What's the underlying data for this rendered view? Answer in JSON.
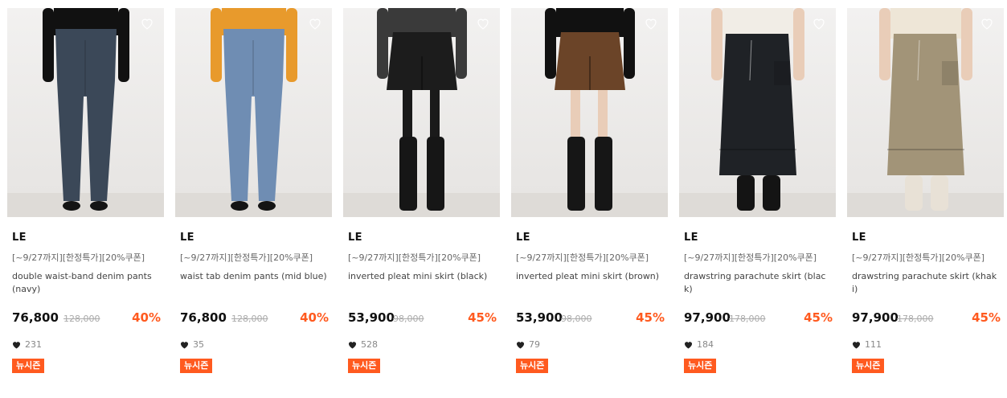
{
  "colors": {
    "accent": "#ff5a1f",
    "price": "#111111",
    "strike": "#aaaaaa"
  },
  "products": [
    {
      "brand": "LE",
      "promo": "[~9/27까지][한정특가][20%쿠폰]",
      "name": "double waist-band denim pants (navy)",
      "price": "76,800",
      "original_price": "128,000",
      "discount": "40%",
      "likes": "231",
      "badge": "뉴시즌",
      "item": "jeans",
      "bottom_color": "#3b4858",
      "top_color": "#111111",
      "shoe": "loafer"
    },
    {
      "brand": "LE",
      "promo": "[~9/27까지][한정특가][20%쿠폰]",
      "name": "waist tab denim pants (mid blue)",
      "price": "76,800",
      "original_price": "128,000",
      "discount": "40%",
      "likes": "35",
      "badge": "뉴시즌",
      "item": "jeans",
      "bottom_color": "#6f8db3",
      "top_color": "#e89a2c",
      "shoe": "loafer"
    },
    {
      "brand": "LE",
      "promo": "[~9/27까지][한정특가][20%쿠폰]",
      "name": "inverted pleat mini skirt (black)",
      "price": "53,900",
      "original_price": "98,000",
      "discount": "45%",
      "likes": "528",
      "badge": "뉴시즌",
      "item": "mini",
      "bottom_color": "#1c1c1c",
      "top_color": "#3a3a3a",
      "shoe": "boots"
    },
    {
      "brand": "LE",
      "promo": "[~9/27까지][한정특가][20%쿠폰]",
      "name": "inverted pleat mini skirt (brown)",
      "price": "53,900",
      "original_price": "98,000",
      "discount": "45%",
      "likes": "79",
      "badge": "뉴시즌",
      "item": "mini",
      "bottom_color": "#6b4428",
      "top_color": "#111111",
      "shoe": "boots"
    },
    {
      "brand": "LE",
      "promo": "[~9/27까지][한정특가][20%쿠폰]",
      "name": "drawstring parachute skirt (black)",
      "price": "97,900",
      "original_price": "178,000",
      "discount": "45%",
      "likes": "184",
      "badge": "뉴시즌",
      "item": "long",
      "bottom_color": "#1f2226",
      "top_color": "#f1ede6",
      "shoe": "chelsea"
    },
    {
      "brand": "LE",
      "promo": "[~9/27까지][한정특가][20%쿠폰]",
      "name": "drawstring parachute skirt (khaki)",
      "price": "97,900",
      "original_price": "178,000",
      "discount": "45%",
      "likes": "111",
      "badge": "뉴시즌",
      "item": "long",
      "bottom_color": "#a29478",
      "top_color": "#eee6d7",
      "shoe": "cream"
    }
  ]
}
